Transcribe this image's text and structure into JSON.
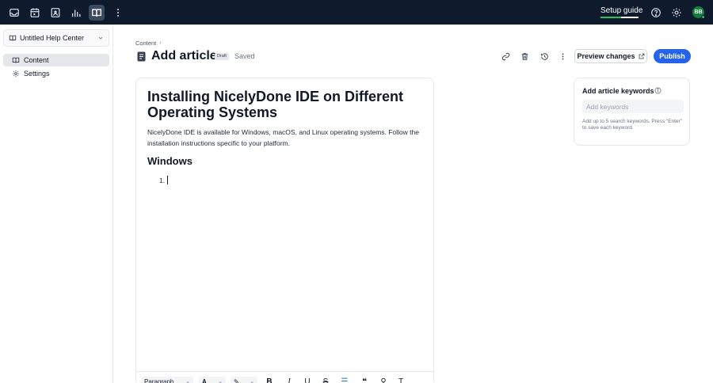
{
  "topbar": {
    "nav_icons": [
      "inbox-icon",
      "calendar-icon",
      "contacts-icon",
      "reports-icon",
      "knowledge-base-icon",
      "more-vertical-icon"
    ],
    "setup_guide": {
      "label": "Setup guide",
      "progress": 0.55
    },
    "help_icon": "help-icon",
    "settings_icon": "gear-icon",
    "avatar_initials": "BB"
  },
  "sidebar": {
    "help_center": "Untitled Help Center",
    "items": [
      {
        "label": "Content",
        "icon": "book-icon",
        "active": true
      },
      {
        "label": "Settings",
        "icon": "gear-icon",
        "active": false
      }
    ]
  },
  "header": {
    "breadcrumb": "Content",
    "title": "Add article",
    "status_badge": "Draft",
    "saved_text": "Saved",
    "preview_label": "Preview changes",
    "publish_label": "Publish"
  },
  "editor": {
    "title": "Installing NicelyDone IDE on Different Operating Systems",
    "paragraph": "NicelyDone IDE is available for Windows, macOS, and Linux operating systems. Follow the installation instructions specific to your platform.",
    "heading": "Windows",
    "list_marker": "1.",
    "toolbar": {
      "block_type": "Paragraph"
    }
  },
  "keywords": {
    "title": "Add article keywords",
    "placeholder": "Add keywords",
    "help": "Add up to 5 search keywords. Press \"Enter\" to save each keyword."
  },
  "colors": {
    "topbar_bg": "#0f1b2d",
    "accent": "#2563eb",
    "progress": "#22c55e",
    "avatar": "#15803d"
  }
}
